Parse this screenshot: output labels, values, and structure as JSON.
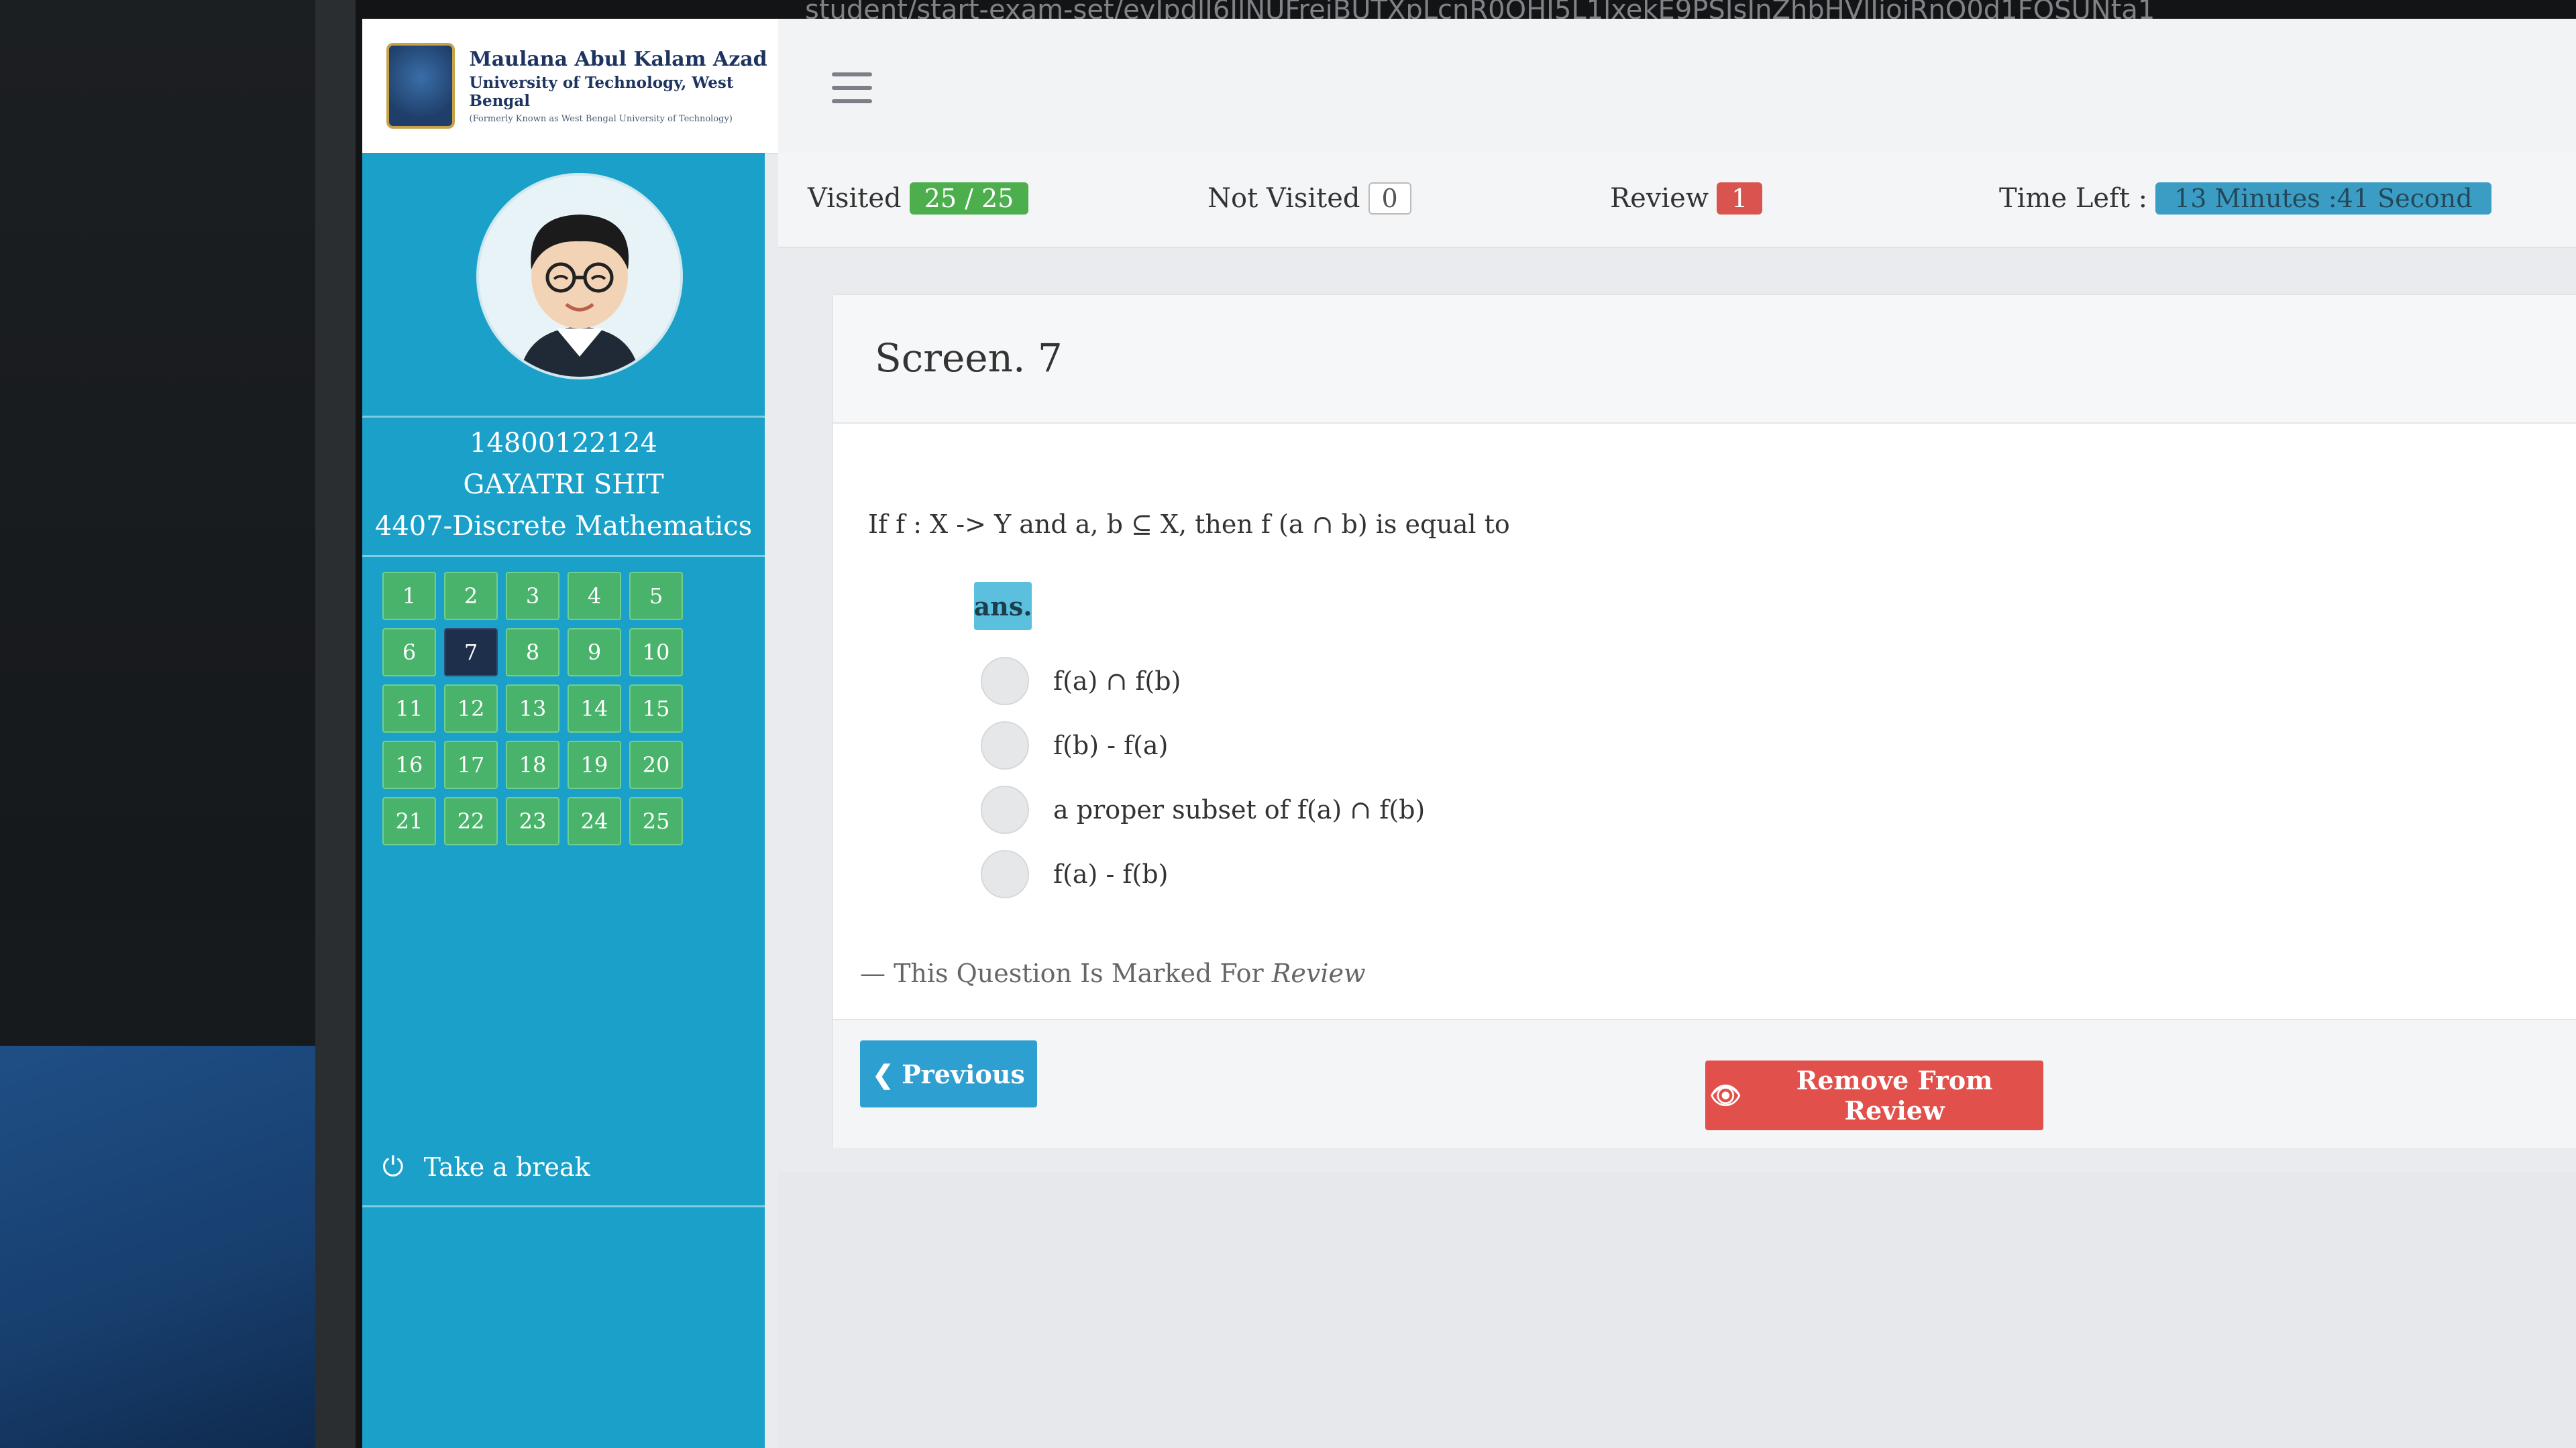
{
  "url_fragment": "student/start-exam-set/eyJpdlI6IlNUFrejBUTXpLcnR0OHI5L1lxekE9PSIsInZhbHVlIjoiRnQ0d1FOSUNta1",
  "header": {
    "logo_line1": "Maulana Abul Kalam Azad",
    "logo_line2": "University of Technology, West Bengal",
    "logo_line3": "(Formerly Known as West Bengal University of Technology)"
  },
  "student": {
    "roll": "14800122124",
    "name": "GAYATRI SHIT",
    "subject": "4407-Discrete Mathematics"
  },
  "questions": [
    "1",
    "2",
    "3",
    "4",
    "5",
    "6",
    "7",
    "8",
    "9",
    "10",
    "11",
    "12",
    "13",
    "14",
    "15",
    "16",
    "17",
    "18",
    "19",
    "20",
    "21",
    "22",
    "23",
    "24",
    "25"
  ],
  "current_question": "7",
  "status": {
    "visited_label": "Visited",
    "visited_value": "25 / 25",
    "not_visited_label": "Not Visited",
    "not_visited_value": "0",
    "review_label": "Review",
    "review_value": "1",
    "time_label": "Time Left :",
    "time_value": "13 Minutes :41 Second"
  },
  "question": {
    "screen_title": "Screen. 7",
    "text": "If f : X -> Y and a, b ⊆ X, then f (a ∩ b) is equal to",
    "ans_label": "ans.",
    "options": [
      "f(a) ∩ f(b)",
      "f(b) - f(a)",
      "a proper subset of f(a) ∩ f(b)",
      "f(a) - f(b)"
    ],
    "review_note_prefix": "— This Question Is Marked For ",
    "review_note_emph": "Review"
  },
  "actions": {
    "previous_label": "Previous",
    "remove_review_label": "Remove From Review"
  },
  "sidebar": {
    "take_break_label": "Take a break"
  },
  "colors": {
    "sidebar": "#1ba1c9",
    "question_button": "#4ab36b",
    "current_question": "#1d2f4a",
    "previous_button": "#2e9fd1",
    "remove_review_button": "#e2504c"
  }
}
